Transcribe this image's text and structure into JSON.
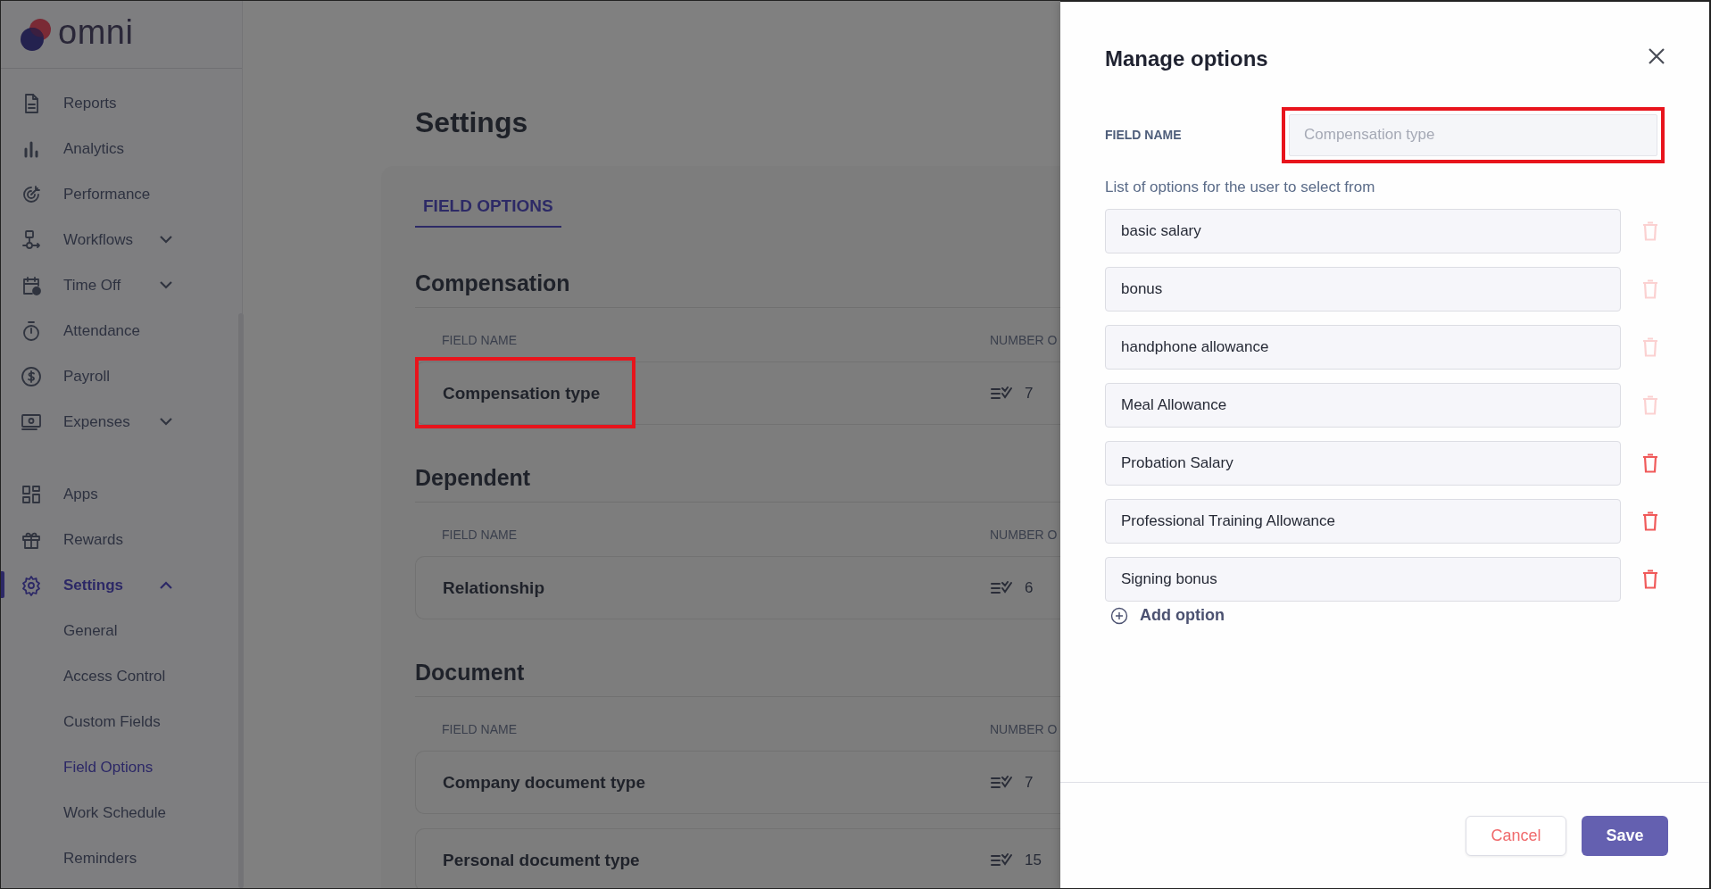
{
  "logo": {
    "text": "omni"
  },
  "sidebar": {
    "groups": [
      [
        {
          "label": "Reports",
          "kind": "link",
          "selected": false
        },
        {
          "label": "Analytics",
          "kind": "link",
          "selected": false
        },
        {
          "label": "Performance",
          "kind": "link",
          "selected": false
        },
        {
          "label": "Workflows",
          "kind": "menu",
          "expanded": false,
          "selected": false
        },
        {
          "label": "Time Off",
          "kind": "menu",
          "expanded": false,
          "selected": false
        },
        {
          "label": "Attendance",
          "kind": "link",
          "selected": false
        },
        {
          "label": "Payroll",
          "kind": "link",
          "selected": false
        },
        {
          "label": "Expenses",
          "kind": "menu",
          "expanded": false,
          "selected": false
        }
      ],
      [
        {
          "label": "Apps",
          "kind": "link",
          "selected": false
        },
        {
          "label": "Rewards",
          "kind": "link",
          "selected": false
        },
        {
          "label": "Settings",
          "kind": "menu",
          "expanded": true,
          "selected": true,
          "children": [
            {
              "label": "General",
              "selected": false
            },
            {
              "label": "Access Control",
              "selected": false
            },
            {
              "label": "Custom Fields",
              "selected": false
            },
            {
              "label": "Field Options",
              "selected": true
            },
            {
              "label": "Work Schedule",
              "selected": false
            },
            {
              "label": "Reminders",
              "selected": false
            }
          ]
        }
      ]
    ]
  },
  "main": {
    "title": "Settings",
    "tabs": [
      {
        "label": "FIELD OPTIONS",
        "selected": true
      }
    ],
    "sections": [
      {
        "title": "Compensation",
        "columns": [
          "FIELD NAME",
          "NUMBER O"
        ],
        "rows": [
          {
            "name": "Compensation type",
            "count": "7",
            "highlighted": true
          }
        ]
      },
      {
        "title": "Dependent",
        "columns": [
          "FIELD NAME",
          "NUMBER O"
        ],
        "rows": [
          {
            "name": "Relationship",
            "count": "6",
            "highlighted": false
          }
        ]
      },
      {
        "title": "Document",
        "columns": [
          "FIELD NAME",
          "NUMBER O"
        ],
        "rows": [
          {
            "name": "Company document type",
            "count": "7",
            "highlighted": false
          },
          {
            "name": "Personal document type",
            "count": "15",
            "highlighted": false
          }
        ]
      }
    ]
  },
  "drawer": {
    "title": "Manage options",
    "field_label": "FIELD NAME",
    "field": {
      "placeholder": "Compensation type",
      "highlighted": true
    },
    "list_label": "List of options for the user to select from",
    "options": [
      {
        "value": "basic salary",
        "disabled": true
      },
      {
        "value": "bonus",
        "disabled": true
      },
      {
        "value": "handphone allowance",
        "disabled": true
      },
      {
        "value": "Meal Allowance",
        "disabled": true
      },
      {
        "value": "Probation Salary",
        "disabled": false
      },
      {
        "value": "Professional Training Allowance",
        "disabled": false
      },
      {
        "value": "Signing bonus",
        "disabled": false
      }
    ],
    "add_label": "Add option",
    "buttons": [
      {
        "label": "Cancel",
        "kind": "secondary"
      },
      {
        "label": "Save",
        "kind": "primary"
      }
    ]
  }
}
